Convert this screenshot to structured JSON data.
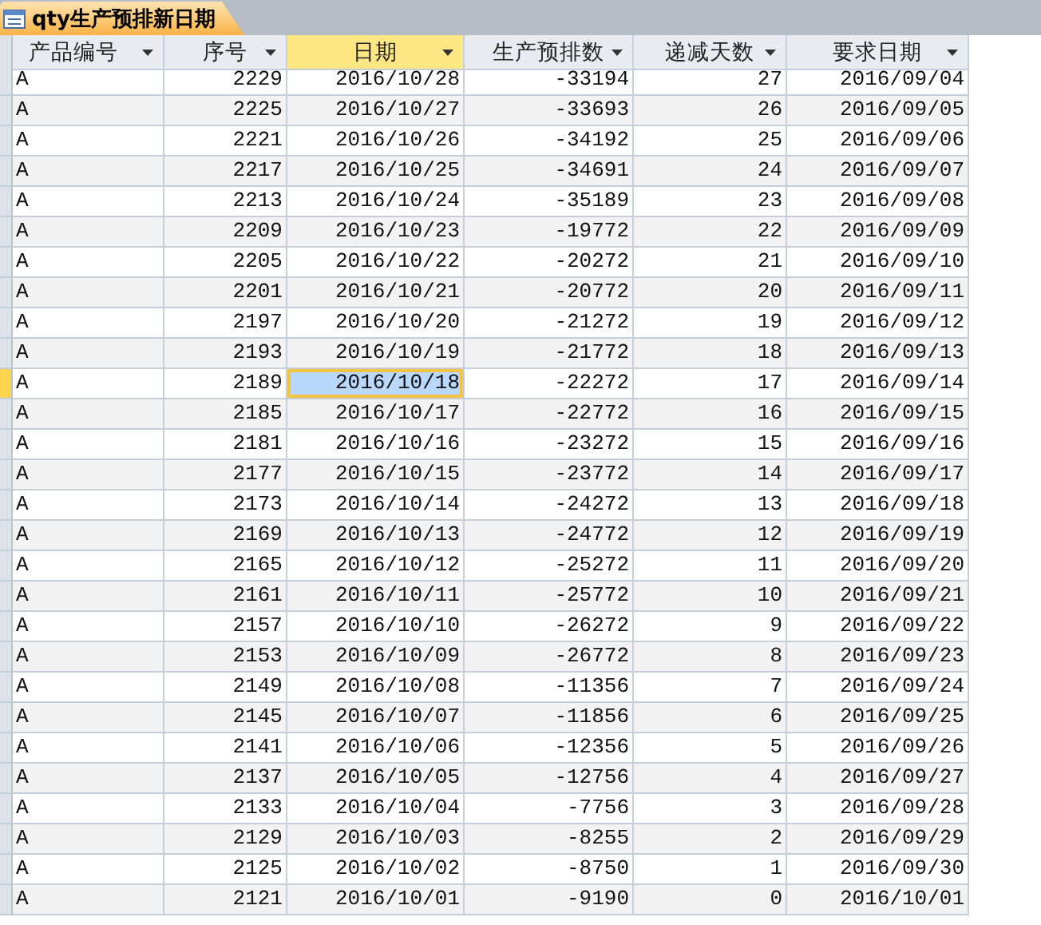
{
  "tab": {
    "title": "qty生产预排新日期",
    "selected": true
  },
  "columns": [
    {
      "label": "产品编号",
      "selected": false
    },
    {
      "label": "序号",
      "selected": false
    },
    {
      "label": "日期",
      "selected": true
    },
    {
      "label": "生产预排数",
      "selected": false
    },
    {
      "label": "递减天数",
      "selected": false
    },
    {
      "label": "要求日期",
      "selected": false
    }
  ],
  "rows": [
    {
      "cells": [
        "A",
        "2229",
        "2016/10/28",
        "-33194",
        "27",
        "2016/09/04"
      ],
      "selected": false
    },
    {
      "cells": [
        "A",
        "2225",
        "2016/10/27",
        "-33693",
        "26",
        "2016/09/05"
      ],
      "selected": false
    },
    {
      "cells": [
        "A",
        "2221",
        "2016/10/26",
        "-34192",
        "25",
        "2016/09/06"
      ],
      "selected": false
    },
    {
      "cells": [
        "A",
        "2217",
        "2016/10/25",
        "-34691",
        "24",
        "2016/09/07"
      ],
      "selected": false
    },
    {
      "cells": [
        "A",
        "2213",
        "2016/10/24",
        "-35189",
        "23",
        "2016/09/08"
      ],
      "selected": false
    },
    {
      "cells": [
        "A",
        "2209",
        "2016/10/23",
        "-19772",
        "22",
        "2016/09/09"
      ],
      "selected": false
    },
    {
      "cells": [
        "A",
        "2205",
        "2016/10/22",
        "-20272",
        "21",
        "2016/09/10"
      ],
      "selected": false
    },
    {
      "cells": [
        "A",
        "2201",
        "2016/10/21",
        "-20772",
        "20",
        "2016/09/11"
      ],
      "selected": false
    },
    {
      "cells": [
        "A",
        "2197",
        "2016/10/20",
        "-21272",
        "19",
        "2016/09/12"
      ],
      "selected": false
    },
    {
      "cells": [
        "A",
        "2193",
        "2016/10/19",
        "-21772",
        "18",
        "2016/09/13"
      ],
      "selected": false
    },
    {
      "cells": [
        "A",
        "2189",
        "2016/10/18",
        "-22272",
        "17",
        "2016/09/14"
      ],
      "selected": true
    },
    {
      "cells": [
        "A",
        "2185",
        "2016/10/17",
        "-22772",
        "16",
        "2016/09/15"
      ],
      "selected": false
    },
    {
      "cells": [
        "A",
        "2181",
        "2016/10/16",
        "-23272",
        "15",
        "2016/09/16"
      ],
      "selected": false
    },
    {
      "cells": [
        "A",
        "2177",
        "2016/10/15",
        "-23772",
        "14",
        "2016/09/17"
      ],
      "selected": false
    },
    {
      "cells": [
        "A",
        "2173",
        "2016/10/14",
        "-24272",
        "13",
        "2016/09/18"
      ],
      "selected": false
    },
    {
      "cells": [
        "A",
        "2169",
        "2016/10/13",
        "-24772",
        "12",
        "2016/09/19"
      ],
      "selected": false
    },
    {
      "cells": [
        "A",
        "2165",
        "2016/10/12",
        "-25272",
        "11",
        "2016/09/20"
      ],
      "selected": false
    },
    {
      "cells": [
        "A",
        "2161",
        "2016/10/11",
        "-25772",
        "10",
        "2016/09/21"
      ],
      "selected": false
    },
    {
      "cells": [
        "A",
        "2157",
        "2016/10/10",
        "-26272",
        "9",
        "2016/09/22"
      ],
      "selected": false
    },
    {
      "cells": [
        "A",
        "2153",
        "2016/10/09",
        "-26772",
        "8",
        "2016/09/23"
      ],
      "selected": false
    },
    {
      "cells": [
        "A",
        "2149",
        "2016/10/08",
        "-11356",
        "7",
        "2016/09/24"
      ],
      "selected": false
    },
    {
      "cells": [
        "A",
        "2145",
        "2016/10/07",
        "-11856",
        "6",
        "2016/09/25"
      ],
      "selected": false
    },
    {
      "cells": [
        "A",
        "2141",
        "2016/10/06",
        "-12356",
        "5",
        "2016/09/26"
      ],
      "selected": false
    },
    {
      "cells": [
        "A",
        "2137",
        "2016/10/05",
        "-12756",
        "4",
        "2016/09/27"
      ],
      "selected": false
    },
    {
      "cells": [
        "A",
        "2133",
        "2016/10/04",
        "-7756",
        "3",
        "2016/09/28"
      ],
      "selected": false
    },
    {
      "cells": [
        "A",
        "2129",
        "2016/10/03",
        "-8255",
        "2",
        "2016/09/29"
      ],
      "selected": false
    },
    {
      "cells": [
        "A",
        "2125",
        "2016/10/02",
        "-8750",
        "1",
        "2016/09/30"
      ],
      "selected": false
    },
    {
      "cells": [
        "A",
        "2121",
        "2016/10/01",
        "-9190",
        "0",
        "2016/10/01"
      ],
      "selected": false
    }
  ]
}
